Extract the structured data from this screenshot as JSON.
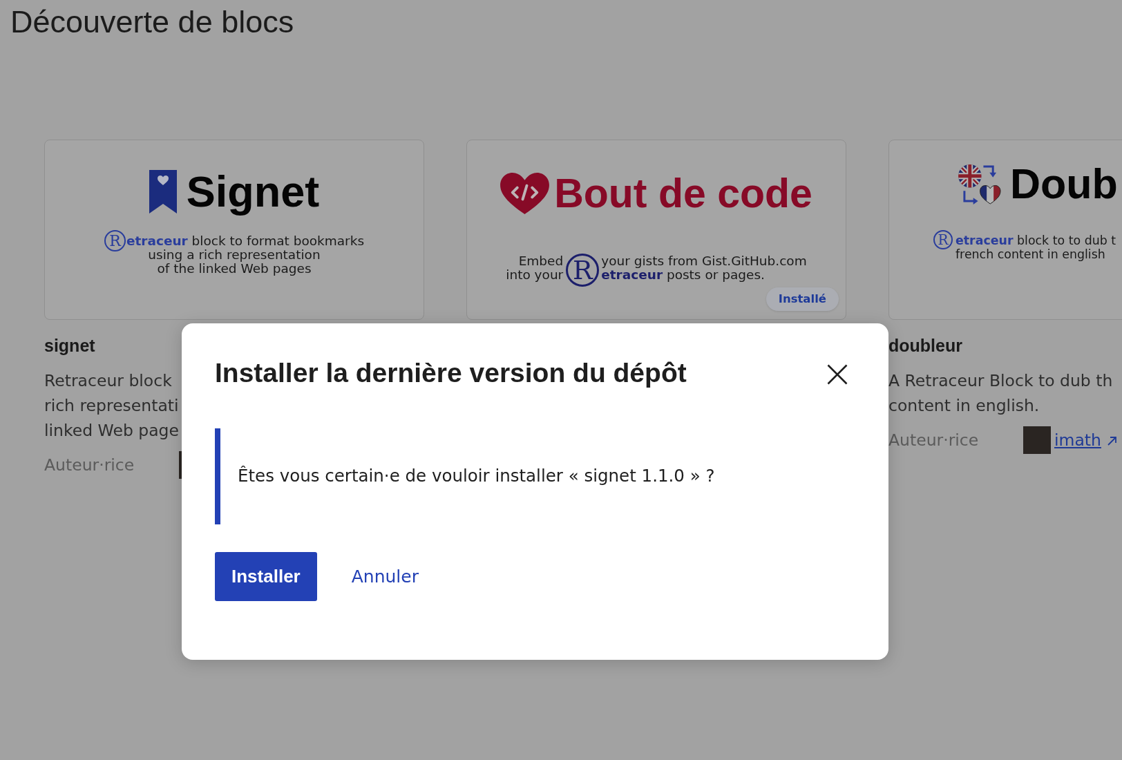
{
  "page": {
    "title": "Découverte de blocs"
  },
  "blocks": [
    {
      "banner": {
        "kind": "signet",
        "title": "Signet",
        "brand_mark": "R",
        "lines": [
          "**etraceur** block to format bookmarks",
          "using a rich representation",
          "of the linked Web pages"
        ]
      },
      "name": "signet",
      "description_lines": [
        "Retraceur block",
        "rich representati",
        "linked Web page"
      ],
      "author": {
        "label": "Auteur·rice"
      }
    },
    {
      "banner": {
        "kind": "code",
        "title": "Bout de code",
        "lead_lines": [
          "Embed",
          "into your"
        ],
        "brand_mark": "R",
        "lines": [
          "your gists from Gist.GitHub.com",
          "**etraceur** posts or pages."
        ]
      },
      "badge": "Installé"
    },
    {
      "banner": {
        "kind": "dub",
        "title": "Doub",
        "brand_mark": "R",
        "lines": [
          "**etraceur** block to to dub t",
          "french content in english"
        ]
      },
      "name": "doubleur",
      "description_lines": [
        "A Retraceur Block to dub th",
        "content in english."
      ],
      "author": {
        "label": "Auteur·rice",
        "name": "imath"
      }
    }
  ],
  "dialog": {
    "title": "Installer la dernière version du dépôt",
    "message": "Êtes vous certain·e de vouloir installer « signet 1.1.0 » ?",
    "buttons": [
      {
        "label": "Installer",
        "kind": "primary"
      },
      {
        "label": "Annuler",
        "kind": "link"
      }
    ]
  }
}
